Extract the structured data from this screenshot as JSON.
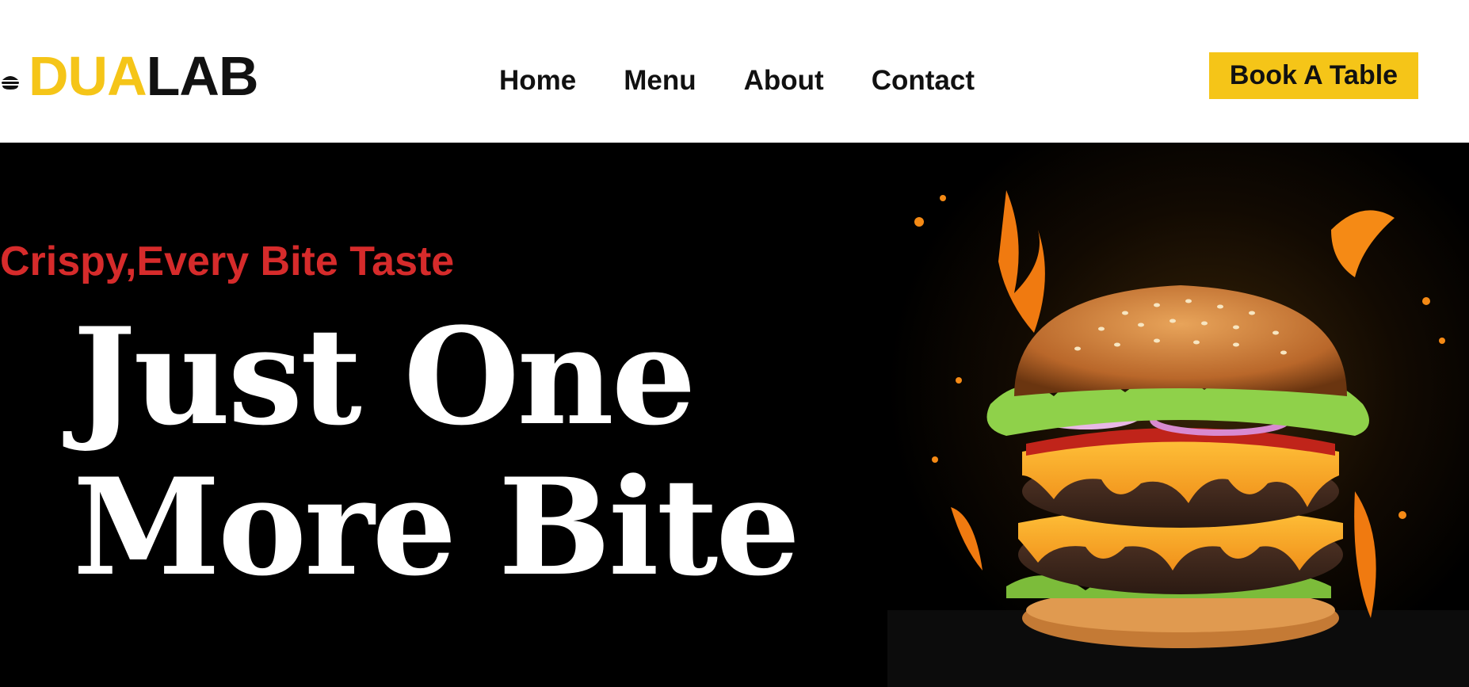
{
  "brand": {
    "logo_part1": "DUA",
    "logo_part2": "LAB",
    "logo_icon": "burger-icon",
    "accent_color": "#f5c518"
  },
  "nav": {
    "items": [
      {
        "label": "Home"
      },
      {
        "label": "Menu"
      },
      {
        "label": "About"
      },
      {
        "label": "Contact"
      }
    ]
  },
  "cta": {
    "book_label": "Book A Table"
  },
  "hero": {
    "tagline": "Crispy,Every Bite Taste",
    "headline_line1": "Just One",
    "headline_line2": "More Bite",
    "tagline_color": "#d62b2b",
    "image": "burger-image"
  }
}
